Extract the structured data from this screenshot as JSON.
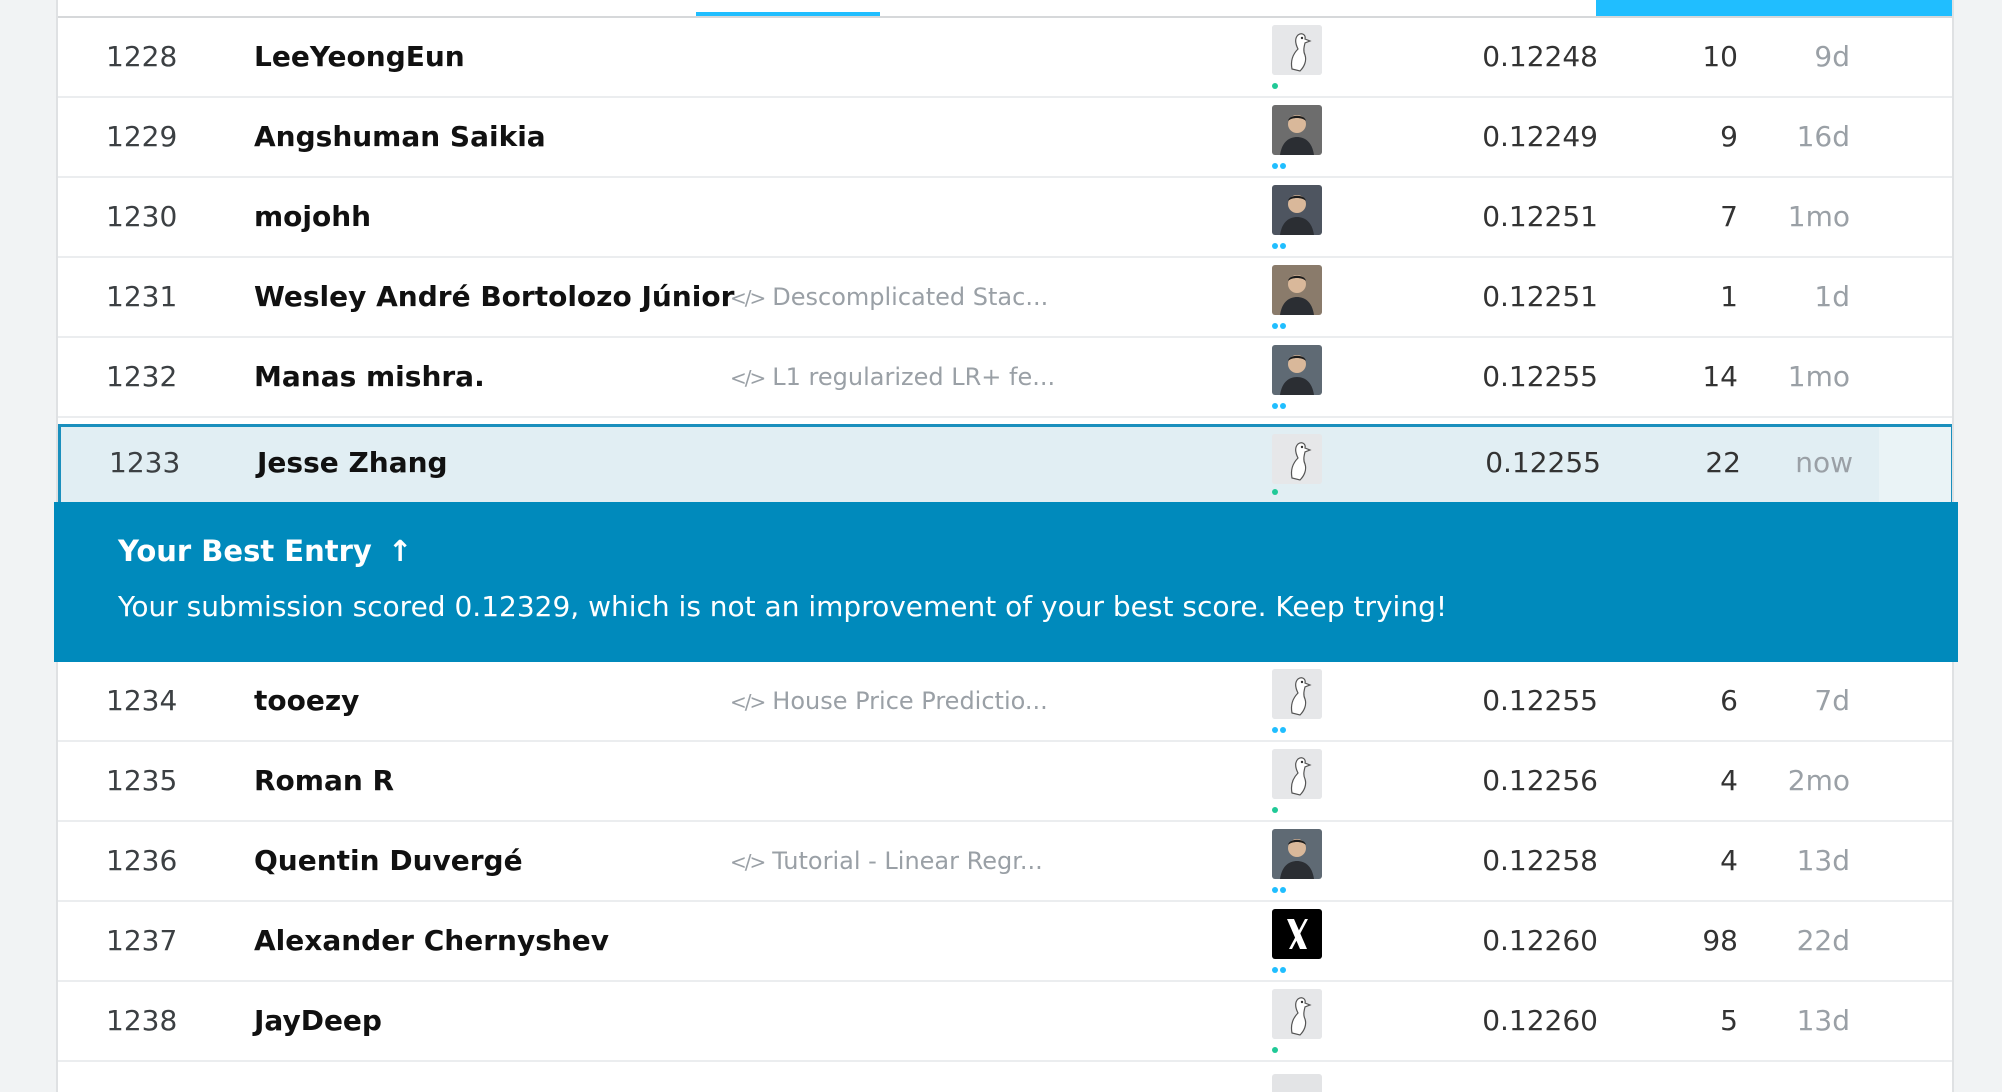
{
  "leaderboard": {
    "rows_above": [
      {
        "rank": "1228",
        "name": "LeeYeongEun",
        "kernel": "",
        "score": "0.12248",
        "entries": "10",
        "last": "9d",
        "avatar": "default-goose-avatar",
        "tier": 1
      },
      {
        "rank": "1229",
        "name": "Angshuman Saikia",
        "kernel": "",
        "score": "0.12249",
        "entries": "9",
        "last": "16d",
        "avatar": "user-photo-avatar",
        "tier": 2
      },
      {
        "rank": "1230",
        "name": "mojohh",
        "kernel": "",
        "score": "0.12251",
        "entries": "7",
        "last": "1mo",
        "avatar": "user-photo-avatar",
        "tier": 2
      },
      {
        "rank": "1231",
        "name": "Wesley André Bortolozo Júnior",
        "kernel": "Descomplicated Stac...",
        "score": "0.12251",
        "entries": "1",
        "last": "1d",
        "avatar": "user-photo-avatar",
        "tier": 2
      },
      {
        "rank": "1232",
        "name": "Manas mishra.",
        "kernel": "L1 regularized LR+ fe...",
        "score": "0.12255",
        "entries": "14",
        "last": "1mo",
        "avatar": "user-photo-avatar",
        "tier": 2
      }
    ],
    "self_row": {
      "rank": "1233",
      "name": "Jesse Zhang",
      "kernel": "",
      "score": "0.12255",
      "entries": "22",
      "last": "now",
      "avatar": "default-goose-avatar",
      "tier": 1
    },
    "rows_below": [
      {
        "rank": "1234",
        "name": "tooezy",
        "kernel": "House Price Predictio...",
        "score": "0.12255",
        "entries": "6",
        "last": "7d",
        "avatar": "default-goose-avatar",
        "tier": 2
      },
      {
        "rank": "1235",
        "name": "Roman R",
        "kernel": "",
        "score": "0.12256",
        "entries": "4",
        "last": "2mo",
        "avatar": "default-goose-avatar",
        "tier": 1
      },
      {
        "rank": "1236",
        "name": "Quentin Duvergé",
        "kernel": "Tutorial - Linear Regr...",
        "score": "0.12258",
        "entries": "4",
        "last": "13d",
        "avatar": "user-photo-avatar",
        "tier": 2
      },
      {
        "rank": "1237",
        "name": "Alexander Chernyshev",
        "kernel": "",
        "score": "0.12260",
        "entries": "98",
        "last": "22d",
        "avatar": "x-logo-avatar",
        "tier": 2
      },
      {
        "rank": "1238",
        "name": "JayDeep",
        "kernel": "",
        "score": "0.12260",
        "entries": "5",
        "last": "13d",
        "avatar": "default-goose-avatar",
        "tier": 1
      }
    ]
  },
  "banner": {
    "title": "Your Best Entry",
    "arrow": "↑",
    "message": "Your submission scored 0.12329, which is not an improvement of your best score. Keep trying!"
  },
  "kernel_icon": "</>",
  "colors": {
    "accent": "#20beff",
    "banner": "#008abc",
    "self_row": "#e1eef3",
    "tier_contributor": "#20c997",
    "tier_expert": "#20beff"
  }
}
